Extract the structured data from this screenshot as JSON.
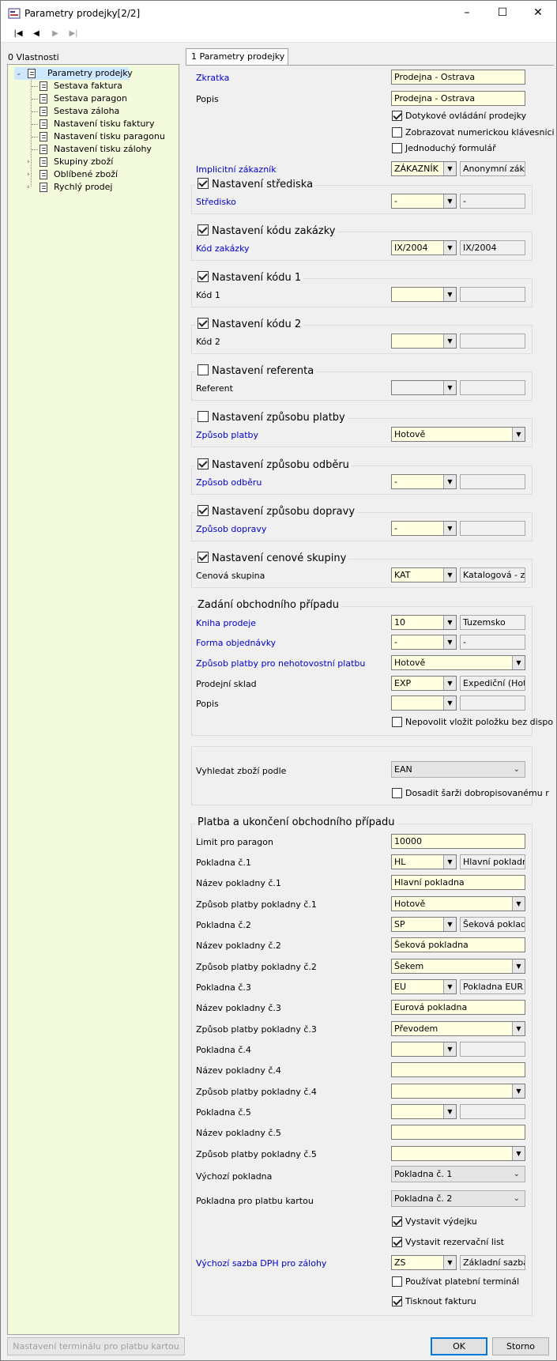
{
  "window": {
    "title": "Parametry prodejky[2/2]",
    "minimize": "–",
    "maximize": "☐",
    "close": "✕"
  },
  "toolbar": {
    "first": "|◀",
    "prev": "◀",
    "next": "▶",
    "last": "▶|"
  },
  "left_label": "0 Vlastnosti",
  "tree": [
    {
      "label": "Parametry prodejky",
      "expander": "⌄"
    },
    {
      "label": "Sestava faktura"
    },
    {
      "label": "Sestava paragon"
    },
    {
      "label": "Sestava záloha"
    },
    {
      "label": "Nastavení tisku faktury"
    },
    {
      "label": "Nastavení tisku paragonu"
    },
    {
      "label": "Nastavení tisku zálohy"
    },
    {
      "label": "Skupiny zboží",
      "expander": "›"
    },
    {
      "label": "Oblíbené zboží",
      "expander": "›"
    },
    {
      "label": "Rychlý prodej",
      "expander": "›"
    }
  ],
  "tab": "1 Parametry prodejky",
  "form": {
    "zkratka": {
      "label": "Zkratka",
      "value": "Prodejna - Ostrava"
    },
    "popis": {
      "label": "Popis",
      "value": "Prodejna - Ostrava"
    },
    "chk_dotykove": "Dotykové ovládání prodejky",
    "chk_numericka": "Zobrazovat numerickou klávesnici",
    "chk_jednoduchy": "Jednoduchý formulář",
    "implicitni": {
      "label": "Implicitní zákazník",
      "code": "ZÁKAZNÍK",
      "name": "Anonymní zákaz"
    },
    "grp_stredisko": {
      "title": "Nastavení střediska",
      "label": "Středisko",
      "code": "-",
      "name": "-"
    },
    "grp_zakazka": {
      "title": "Nastavení kódu zakázky",
      "label": "Kód zakázky",
      "code": "IX/2004",
      "name": "IX/2004"
    },
    "grp_kod1": {
      "title": "Nastavení kódu 1",
      "label": "Kód 1",
      "code": "",
      "name": ""
    },
    "grp_kod2": {
      "title": "Nastavení kódu 2",
      "label": "Kód 2",
      "code": "",
      "name": ""
    },
    "grp_referent": {
      "title": "Nastavení referenta",
      "label": "Referent",
      "code": "",
      "name": ""
    },
    "grp_platba": {
      "title": "Nastavení způsobu platby",
      "label": "Způsob platby",
      "value": "Hotově"
    },
    "grp_odber": {
      "title": "Nastavení způsobu odběru",
      "label": "Způsob odběru",
      "code": "-",
      "name": ""
    },
    "grp_doprava": {
      "title": "Nastavení způsobu dopravy",
      "label": "Způsob dopravy",
      "code": "-",
      "name": ""
    },
    "grp_cenova": {
      "title": "Nastavení cenové skupiny",
      "label": "Cenová skupina",
      "code": "KAT",
      "name": "Katalogová - zá"
    },
    "grp_zadani": {
      "title": "Zadání obchodního případu",
      "kniha": {
        "label": "Kniha prodeje",
        "code": "10",
        "name": "Tuzemsko"
      },
      "forma": {
        "label": "Forma objednávky",
        "code": "-",
        "name": "-"
      },
      "nehotov": {
        "label": "Způsob platby pro nehotovostní platbu",
        "value": "Hotově"
      },
      "sklad": {
        "label": "Prodejní sklad",
        "code": "EXP",
        "name": "Expediční (Hotov"
      },
      "popis": {
        "label": "Popis",
        "code": "",
        "name": ""
      },
      "chk_nepovolit": "Nepovolit vložit položku bez dispo"
    },
    "vyhledat": {
      "label": "Vyhledat zboží podle",
      "value": "EAN",
      "chk_dosadit": "Dosadit šarži dobropisovanému r"
    },
    "grp_platba_ukonceni": {
      "title": "Platba a ukončení obchodního případu",
      "limit": {
        "label": "Limit pro paragon",
        "value": "10000"
      },
      "pokl1": {
        "label": "Pokladna č.1",
        "code": "HL",
        "name": "Hlavní pokladna"
      },
      "nazev1": {
        "label": "Název pokladny č.1",
        "value": "Hlavní pokladna"
      },
      "zpusob1": {
        "label": "Způsob platby pokladny č.1",
        "value": "Hotově"
      },
      "pokl2": {
        "label": "Pokladna č.2",
        "code": "SP",
        "name": "Šeková pokladna"
      },
      "nazev2": {
        "label": "Název pokladny č.2",
        "value": "Šeková pokladna"
      },
      "zpusob2": {
        "label": "Způsob platby pokladny č.2",
        "value": "Šekem"
      },
      "pokl3": {
        "label": "Pokladna č.3",
        "code": "EU",
        "name": "Pokladna EUR"
      },
      "nazev3": {
        "label": "Název pokladny č.3",
        "value": "Eurová pokladna"
      },
      "zpusob3": {
        "label": "Způsob platby pokladny č.3",
        "value": "Převodem"
      },
      "pokl4": {
        "label": "Pokladna č.4",
        "code": "",
        "name": ""
      },
      "nazev4": {
        "label": "Název pokladny č.4",
        "value": ""
      },
      "zpusob4": {
        "label": "Způsob platby pokladny č.4",
        "value": ""
      },
      "pokl5": {
        "label": "Pokladna č.5",
        "code": "",
        "name": ""
      },
      "nazev5": {
        "label": "Název pokladny č.5",
        "value": ""
      },
      "zpusob5": {
        "label": "Způsob platby pokladny č.5",
        "value": ""
      },
      "vychozi": {
        "label": "Výchozí pokladna",
        "value": "Pokladna č. 1"
      },
      "kartou": {
        "label": "Pokladna pro platbu kartou",
        "value": "Pokladna č. 2"
      },
      "chk_vydejku": "Vystavit výdejku",
      "chk_rezervacni": "Vystavit rezervační list",
      "sazba": {
        "label": "Výchozí sazba DPH pro zálohy",
        "code": "ZS",
        "name": "Základní sazba D"
      },
      "chk_terminal": "Používat platební terminál",
      "chk_faktura": "Tisknout fakturu"
    }
  },
  "buttons": {
    "terminal": "Nastavení terminálu pro platbu kartou",
    "ok": "OK",
    "storno": "Storno"
  },
  "colors": {
    "input_bg": "#ffffe1",
    "tree_bg": "#f4fbdc",
    "blue_label": "#0000cc",
    "accent": "#0078d7"
  }
}
